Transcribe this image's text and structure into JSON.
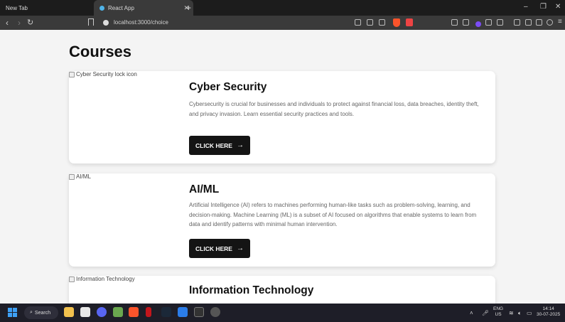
{
  "browser": {
    "tabs": [
      {
        "label": "New Tab"
      },
      {
        "label": "React App"
      }
    ],
    "url": "localhost:3000/choice"
  },
  "page": {
    "title": "Courses",
    "courses": [
      {
        "img_alt": "Cyber Security lock icon",
        "title": "Cyber Security",
        "description": "Cybersecurity is crucial for businesses and individuals to protect against financial loss, data breaches, identity theft, and privacy invasion. Learn essential security practices and tools.",
        "button": "CLICK HERE"
      },
      {
        "img_alt": "AI/ML",
        "title": "AI/ML",
        "description": "Artificial Intelligence (AI) refers to machines performing human-like tasks such as problem-solving, learning, and decision-making. Machine Learning (ML) is a subset of AI focused on algorithms that enable systems to learn from data and identify patterns with minimal human intervention.",
        "button": "CLICK HERE"
      },
      {
        "img_alt": "Information Technology",
        "title": "Information Technology"
      }
    ]
  },
  "taskbar": {
    "search_label": "Search",
    "lang_line1": "ENG",
    "lang_line2": "US",
    "time": "14:14",
    "date": "30-07-2025"
  },
  "icons": {
    "cta": "arrow-right-icon",
    "window_start": "windows-logo-icon"
  },
  "colors": {
    "page_bg": "#f4f4f4",
    "button_bg": "#141414",
    "card_bg": "#ffffff"
  }
}
